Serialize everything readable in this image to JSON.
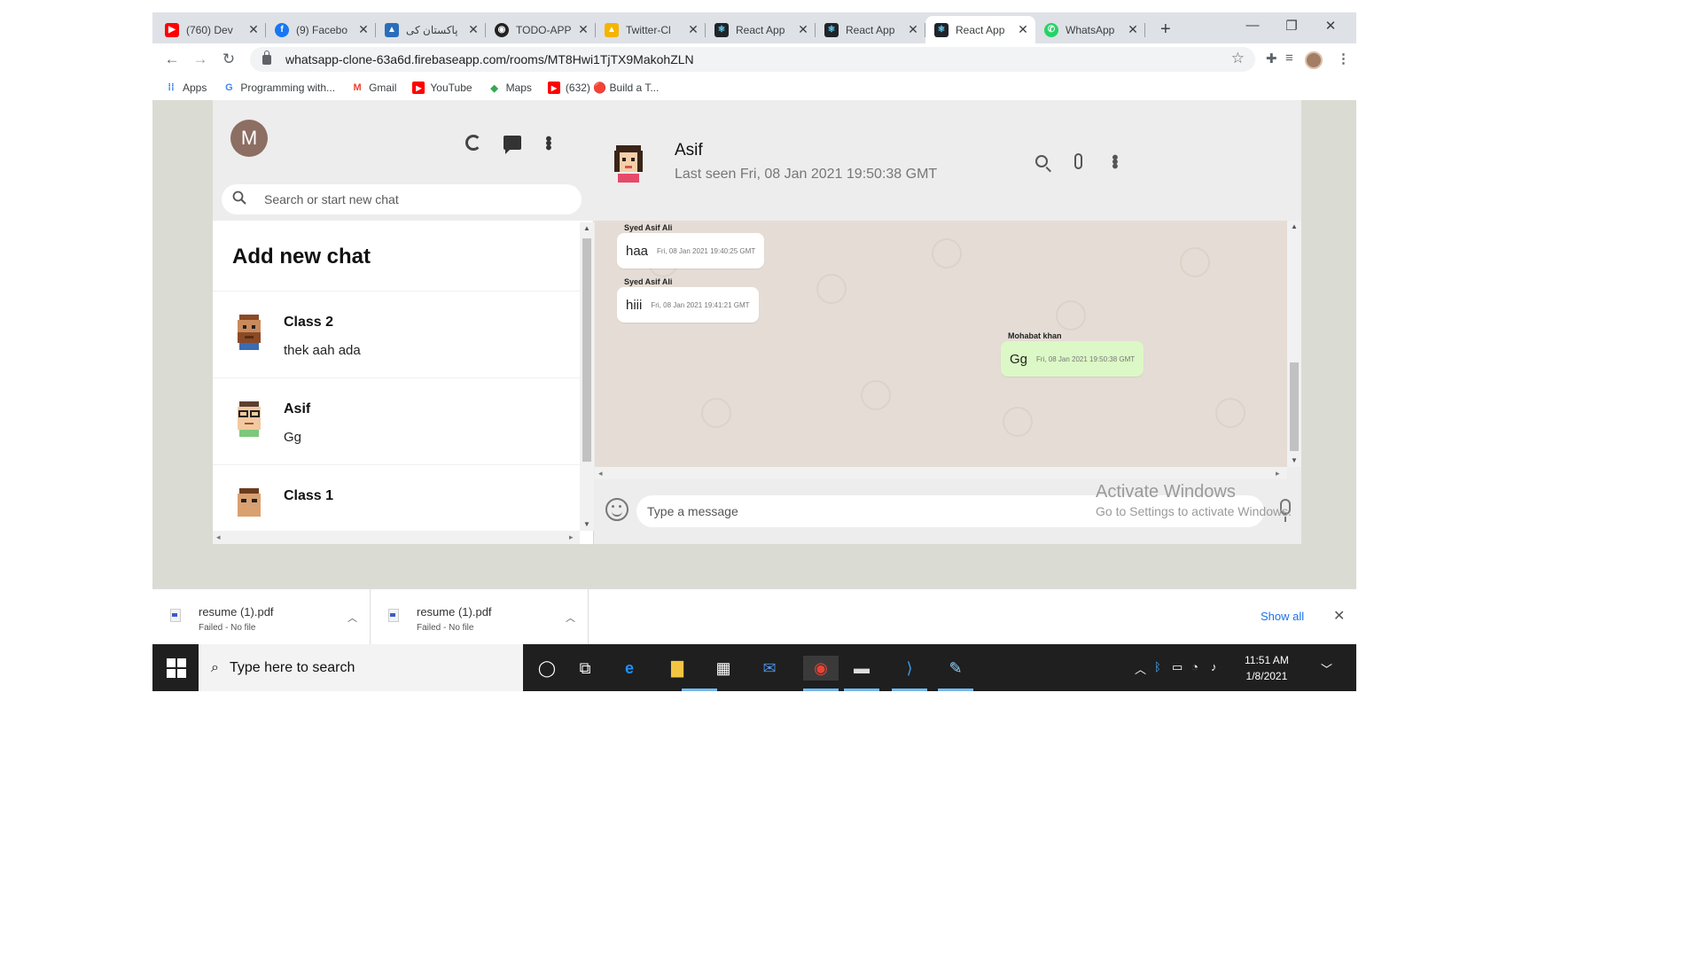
{
  "browser": {
    "tabs": [
      {
        "title": "(760) Dev",
        "favicon_color": "#ff0000",
        "icon": "youtube-icon"
      },
      {
        "title": "(9) Facebo",
        "favicon_color": "#1877f2",
        "icon": "facebook-icon"
      },
      {
        "title": "پاکستان کی",
        "favicon_color": "#2a6ebb",
        "icon": "news-icon"
      },
      {
        "title": "TODO-APP",
        "favicon_color": "#222222",
        "icon": "github-icon"
      },
      {
        "title": "Twitter-Cl",
        "favicon_color": "#f4b400",
        "icon": "firebase-icon"
      },
      {
        "title": "React App",
        "favicon_color": "#20232a",
        "icon": "react-icon"
      },
      {
        "title": "React App",
        "favicon_color": "#20232a",
        "icon": "react-icon"
      },
      {
        "title": "React App",
        "favicon_color": "#20232a",
        "icon": "react-icon"
      },
      {
        "title": "WhatsApp",
        "favicon_color": "#25d366",
        "icon": "whatsapp-icon"
      }
    ],
    "active_tab": 7,
    "url": "whatsapp-clone-63a6d.firebaseapp.com/rooms/MT8Hwi1TjTX9MakohZLN",
    "bookmarks": [
      {
        "label": "Apps",
        "icon": "apps-grid-icon"
      },
      {
        "label": "Programming with...",
        "icon": "google-icon"
      },
      {
        "label": "Gmail",
        "icon": "gmail-icon"
      },
      {
        "label": "YouTube",
        "icon": "youtube-icon"
      },
      {
        "label": "Maps",
        "icon": "maps-icon"
      },
      {
        "label": "(632) 🔴 Build a T...",
        "icon": "youtube-icon"
      }
    ]
  },
  "sidebar": {
    "user_initial": "M",
    "search_placeholder": "Search or start new chat",
    "add_new_chat": "Add new chat",
    "chats": [
      {
        "name": "Class 2",
        "last_message": "thek aah ada"
      },
      {
        "name": "Asif",
        "last_message": "Gg"
      },
      {
        "name": "Class 1",
        "last_message": ""
      }
    ]
  },
  "chat": {
    "name": "Asif",
    "last_seen": "Last seen Fri, 08 Jan 2021 19:50:38 GMT",
    "messages": [
      {
        "sender": "Syed Asif Ali",
        "text": "haa",
        "timestamp": "Fri, 08 Jan 2021 19:40:25 GMT",
        "mine": false
      },
      {
        "sender": "Syed Asif Ali",
        "text": "hiii",
        "timestamp": "Fri, 08 Jan 2021 19:41:21 GMT",
        "mine": false
      },
      {
        "sender": "Mohabat khan",
        "text": "Gg",
        "timestamp": "Fri, 08 Jan 2021 19:50:38 GMT",
        "mine": true
      }
    ],
    "input_placeholder": "Type a message"
  },
  "watermark": {
    "line1": "Activate Windows",
    "line2": "Go to Settings to activate Windows."
  },
  "downloads": {
    "items": [
      {
        "name": "resume (1).pdf",
        "status": "Failed - No file"
      },
      {
        "name": "resume (1).pdf",
        "status": "Failed - No file"
      }
    ],
    "show_all": "Show all"
  },
  "taskbar": {
    "search_placeholder": "Type here to search",
    "time": "11:51 AM",
    "date": "1/8/2021"
  },
  "colors": {
    "chat_background": "#e5ddd5",
    "my_bubble": "#dcf8c6",
    "other_bubble": "#ffffff",
    "avatar_m": "#8d6e63"
  }
}
